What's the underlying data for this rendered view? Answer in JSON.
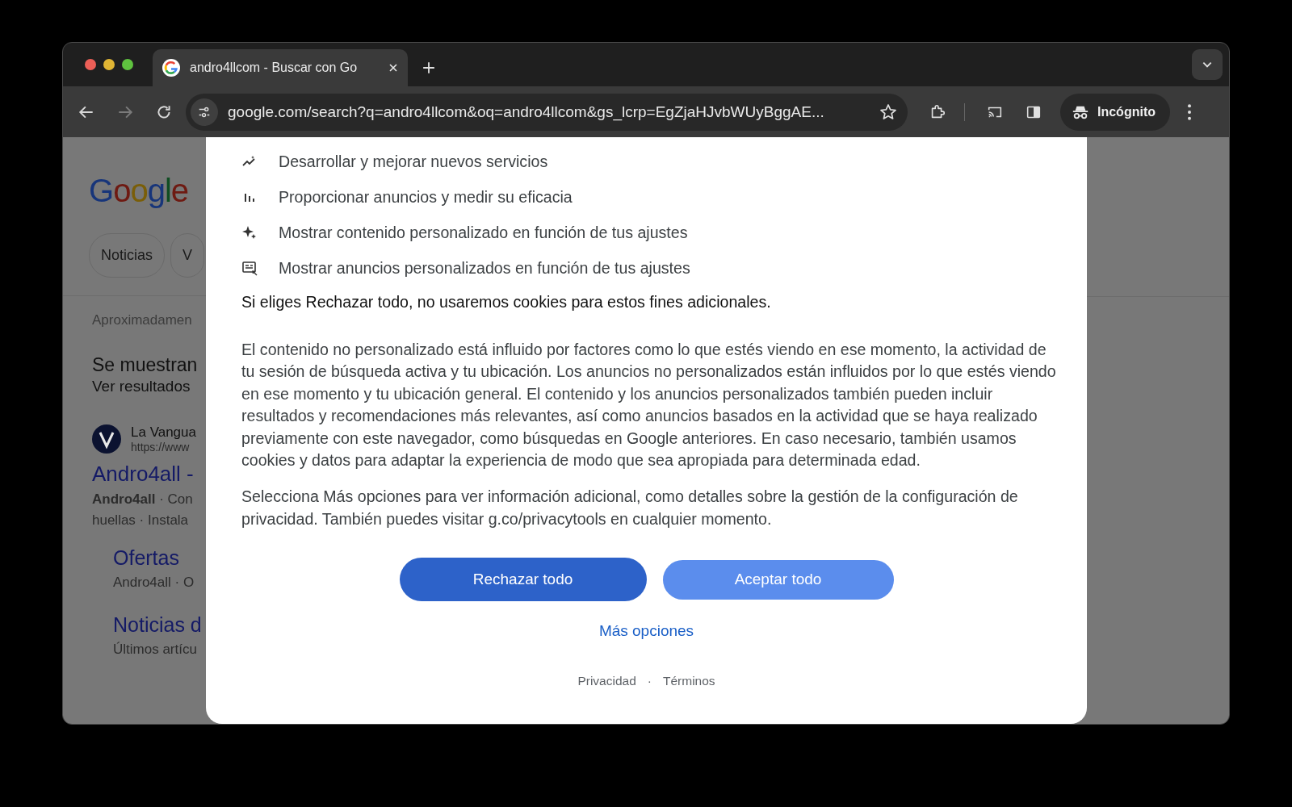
{
  "browser": {
    "tab": {
      "title": "andro4llcom - Buscar con Go",
      "selected": true
    },
    "url": "google.com/search?q=andro4llcom&oq=andro4llcom&gs_lcrp=EgZjaHJvbWUyBggAE...",
    "profile": "Incógnito"
  },
  "background_page": {
    "logo": "Google",
    "chips": [
      "Noticias",
      "V"
    ],
    "result_count": "Aproximadamen",
    "notice": [
      "Se muestran",
      "Ver resultados"
    ],
    "result": {
      "site": "La Vangua",
      "url": "https://www",
      "title": "Andro4all -",
      "snippet": [
        "**Andro4all** · Con",
        "huellas · Instala"
      ]
    },
    "sublinks": [
      {
        "title": "Ofertas",
        "snippet": "Andro4all · O"
      },
      {
        "title": "Noticias d",
        "snippet": "Últimos artícu"
      }
    ]
  },
  "dialog": {
    "purposes": [
      {
        "kind": "trend",
        "text": "Desarrollar y mejorar nuevos servicios"
      },
      {
        "kind": "bars",
        "text": "Proporcionar anuncios y medir su eficacia"
      },
      {
        "kind": "sparkle",
        "text": "Mostrar contenido personalizado en función de tus ajustes"
      },
      {
        "kind": "ad",
        "text": "Mostrar anuncios personalizados en función de tus ajustes"
      }
    ],
    "reject_note": "Si eliges Rechazar todo, no usaremos cookies para estos fines adicionales.",
    "paragraphs": [
      "El contenido no personalizado está influido por factores como lo que estés viendo en ese momento, la actividad de tu sesión de búsqueda activa y tu ubicación. Los anuncios no personalizados están influidos por lo que estés viendo en ese momento y tu ubicación general. El contenido y los anuncios personalizados también pueden incluir resultados y recomendaciones más relevantes, así como anuncios basados en la actividad que se haya realizado previamente con este navegador, como búsquedas en Google anteriores. En caso necesario, también usamos cookies y datos para adaptar la experiencia de modo que sea apropiada para determinada edad.",
      "Selecciona Más opciones para ver información adicional, como detalles sobre la gestión de la configuración de privacidad. También puedes visitar g.co/privacytools en cualquier momento."
    ],
    "buttons": [
      {
        "label": "Rechazar todo",
        "kind": "focused"
      },
      {
        "label": "Aceptar todo",
        "kind": "normal"
      }
    ],
    "more_link": "Más opciones",
    "footer": {
      "links": [
        "Privacidad",
        "Términos"
      ],
      "separator": "·"
    }
  }
}
